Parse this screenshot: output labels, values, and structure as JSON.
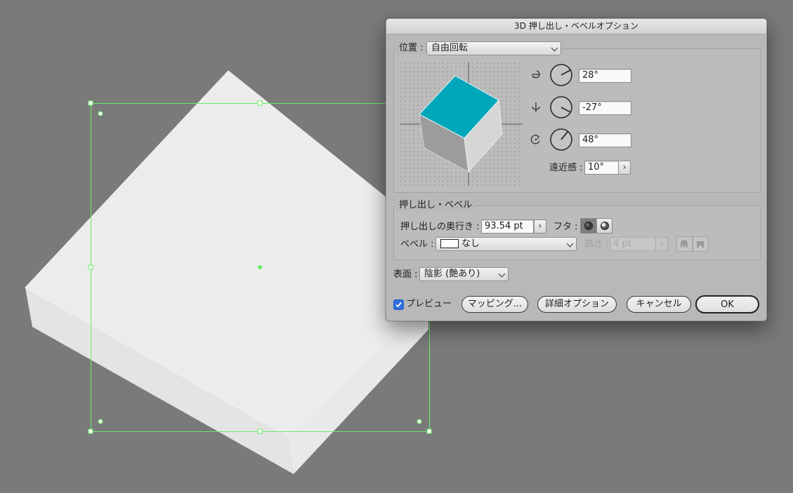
{
  "dialog": {
    "title": "3D 押し出し・ベベルオプション",
    "position": {
      "label": "位置 :",
      "preset_value": "自由回転",
      "rotations": [
        {
          "axis_icon": "x-axis-rotate-icon",
          "value": "28°"
        },
        {
          "axis_icon": "y-axis-rotate-icon",
          "value": "-27°"
        },
        {
          "axis_icon": "z-axis-rotate-icon",
          "value": "48°"
        }
      ],
      "perspective_label": "遠近感 :",
      "perspective_value": "10°",
      "cube_front_color": "#00a6b9"
    },
    "extrude": {
      "section_label": "押し出し・ベベル",
      "depth_label": "押し出しの奥行き :",
      "depth_value": "93.54 pt",
      "cap_label": "フタ :",
      "bevel_label": "ベベル :",
      "bevel_value": "なし",
      "height_label": "高さ :",
      "height_value": "4 pt"
    },
    "surface": {
      "label": "表面 :",
      "value": "陰影 (艶あり)"
    },
    "preview": {
      "label": "プレビュー",
      "checked": true
    },
    "buttons": {
      "mapping": "マッピング...",
      "more_options": "詳細オプション",
      "cancel": "キャンセル",
      "ok": "OK"
    }
  },
  "colors": {
    "selection": "#66ee66",
    "canvas_bg": "#7a7a7a",
    "accent": "#2f6fe0"
  }
}
